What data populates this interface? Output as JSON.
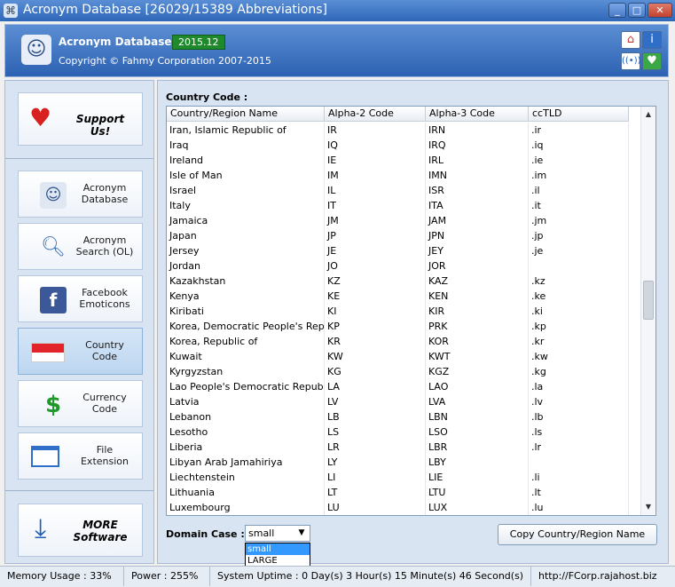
{
  "window": {
    "title": "Acronym Database [26029/15389 Abbreviations]",
    "controls": [
      "_",
      "□",
      "✕"
    ]
  },
  "header": {
    "app_name": "Acronym Database",
    "version": "2015.12",
    "copyright": "Copyright © Fahmy Corporation 2007-2015",
    "buttons": [
      "home-icon",
      "info-icon",
      "rss-icon",
      "heart-icon"
    ]
  },
  "sidebar": {
    "support_label": "Support Us!",
    "items": [
      {
        "label": "Acronym Database",
        "icon": "finder-icon"
      },
      {
        "label": "Acronym Search (OL)",
        "icon": "magnifier-icon"
      },
      {
        "label": "Facebook Emoticons",
        "icon": "facebook-icon"
      },
      {
        "label": "Country Code",
        "icon": "flag-icon"
      },
      {
        "label": "Currency Code",
        "icon": "dollar-icon"
      },
      {
        "label": "File Extension",
        "icon": "window-icon"
      }
    ],
    "more_label": "MORE Software"
  },
  "main": {
    "section_label": "Country Code :",
    "columns": [
      "Country/Region Name",
      "Alpha-2 Code",
      "Alpha-3 Code",
      "ccTLD"
    ],
    "rows": [
      [
        "Iran, Islamic Republic of",
        "IR",
        "IRN",
        ".ir"
      ],
      [
        "Iraq",
        "IQ",
        "IRQ",
        ".iq"
      ],
      [
        "Ireland",
        "IE",
        "IRL",
        ".ie"
      ],
      [
        "Isle of Man",
        "IM",
        "IMN",
        ".im"
      ],
      [
        "Israel",
        "IL",
        "ISR",
        ".il"
      ],
      [
        "Italy",
        "IT",
        "ITA",
        ".it"
      ],
      [
        "Jamaica",
        "JM",
        "JAM",
        ".jm"
      ],
      [
        "Japan",
        "JP",
        "JPN",
        ".jp"
      ],
      [
        "Jersey",
        "JE",
        "JEY",
        ".je"
      ],
      [
        "Jordan",
        "JO",
        "JOR",
        ""
      ],
      [
        "Kazakhstan",
        "KZ",
        "KAZ",
        ".kz"
      ],
      [
        "Kenya",
        "KE",
        "KEN",
        ".ke"
      ],
      [
        "Kiribati",
        "KI",
        "KIR",
        ".ki"
      ],
      [
        "Korea, Democratic People's Repu...",
        "KP",
        "PRK",
        ".kp"
      ],
      [
        "Korea, Republic of",
        "KR",
        "KOR",
        ".kr"
      ],
      [
        "Kuwait",
        "KW",
        "KWT",
        ".kw"
      ],
      [
        "Kyrgyzstan",
        "KG",
        "KGZ",
        ".kg"
      ],
      [
        "Lao People's Democratic Republic",
        "LA",
        "LAO",
        ".la"
      ],
      [
        "Latvia",
        "LV",
        "LVA",
        ".lv"
      ],
      [
        "Lebanon",
        "LB",
        "LBN",
        ".lb"
      ],
      [
        "Lesotho",
        "LS",
        "LSO",
        ".ls"
      ],
      [
        "Liberia",
        "LR",
        "LBR",
        ".lr"
      ],
      [
        "Libyan Arab Jamahiriya",
        "LY",
        "LBY",
        ""
      ],
      [
        "Liechtenstein",
        "LI",
        "LIE",
        ".li"
      ],
      [
        "Lithuania",
        "LT",
        "LTU",
        ".lt"
      ],
      [
        "Luxembourg",
        "LU",
        "LUX",
        ".lu"
      ]
    ],
    "domain_case_label": "Domain Case :",
    "domain_case_value": "small",
    "domain_case_options": [
      "small",
      "LARGE"
    ],
    "copy_button": "Copy Country/Region Name"
  },
  "status": {
    "memory": "Memory Usage : 33%",
    "power": "Power : 255%",
    "uptime": "System Uptime : 0 Day(s) 3 Hour(s) 15 Minute(s) 46 Second(s)",
    "url": "http://FCorp.rajahost.biz"
  }
}
